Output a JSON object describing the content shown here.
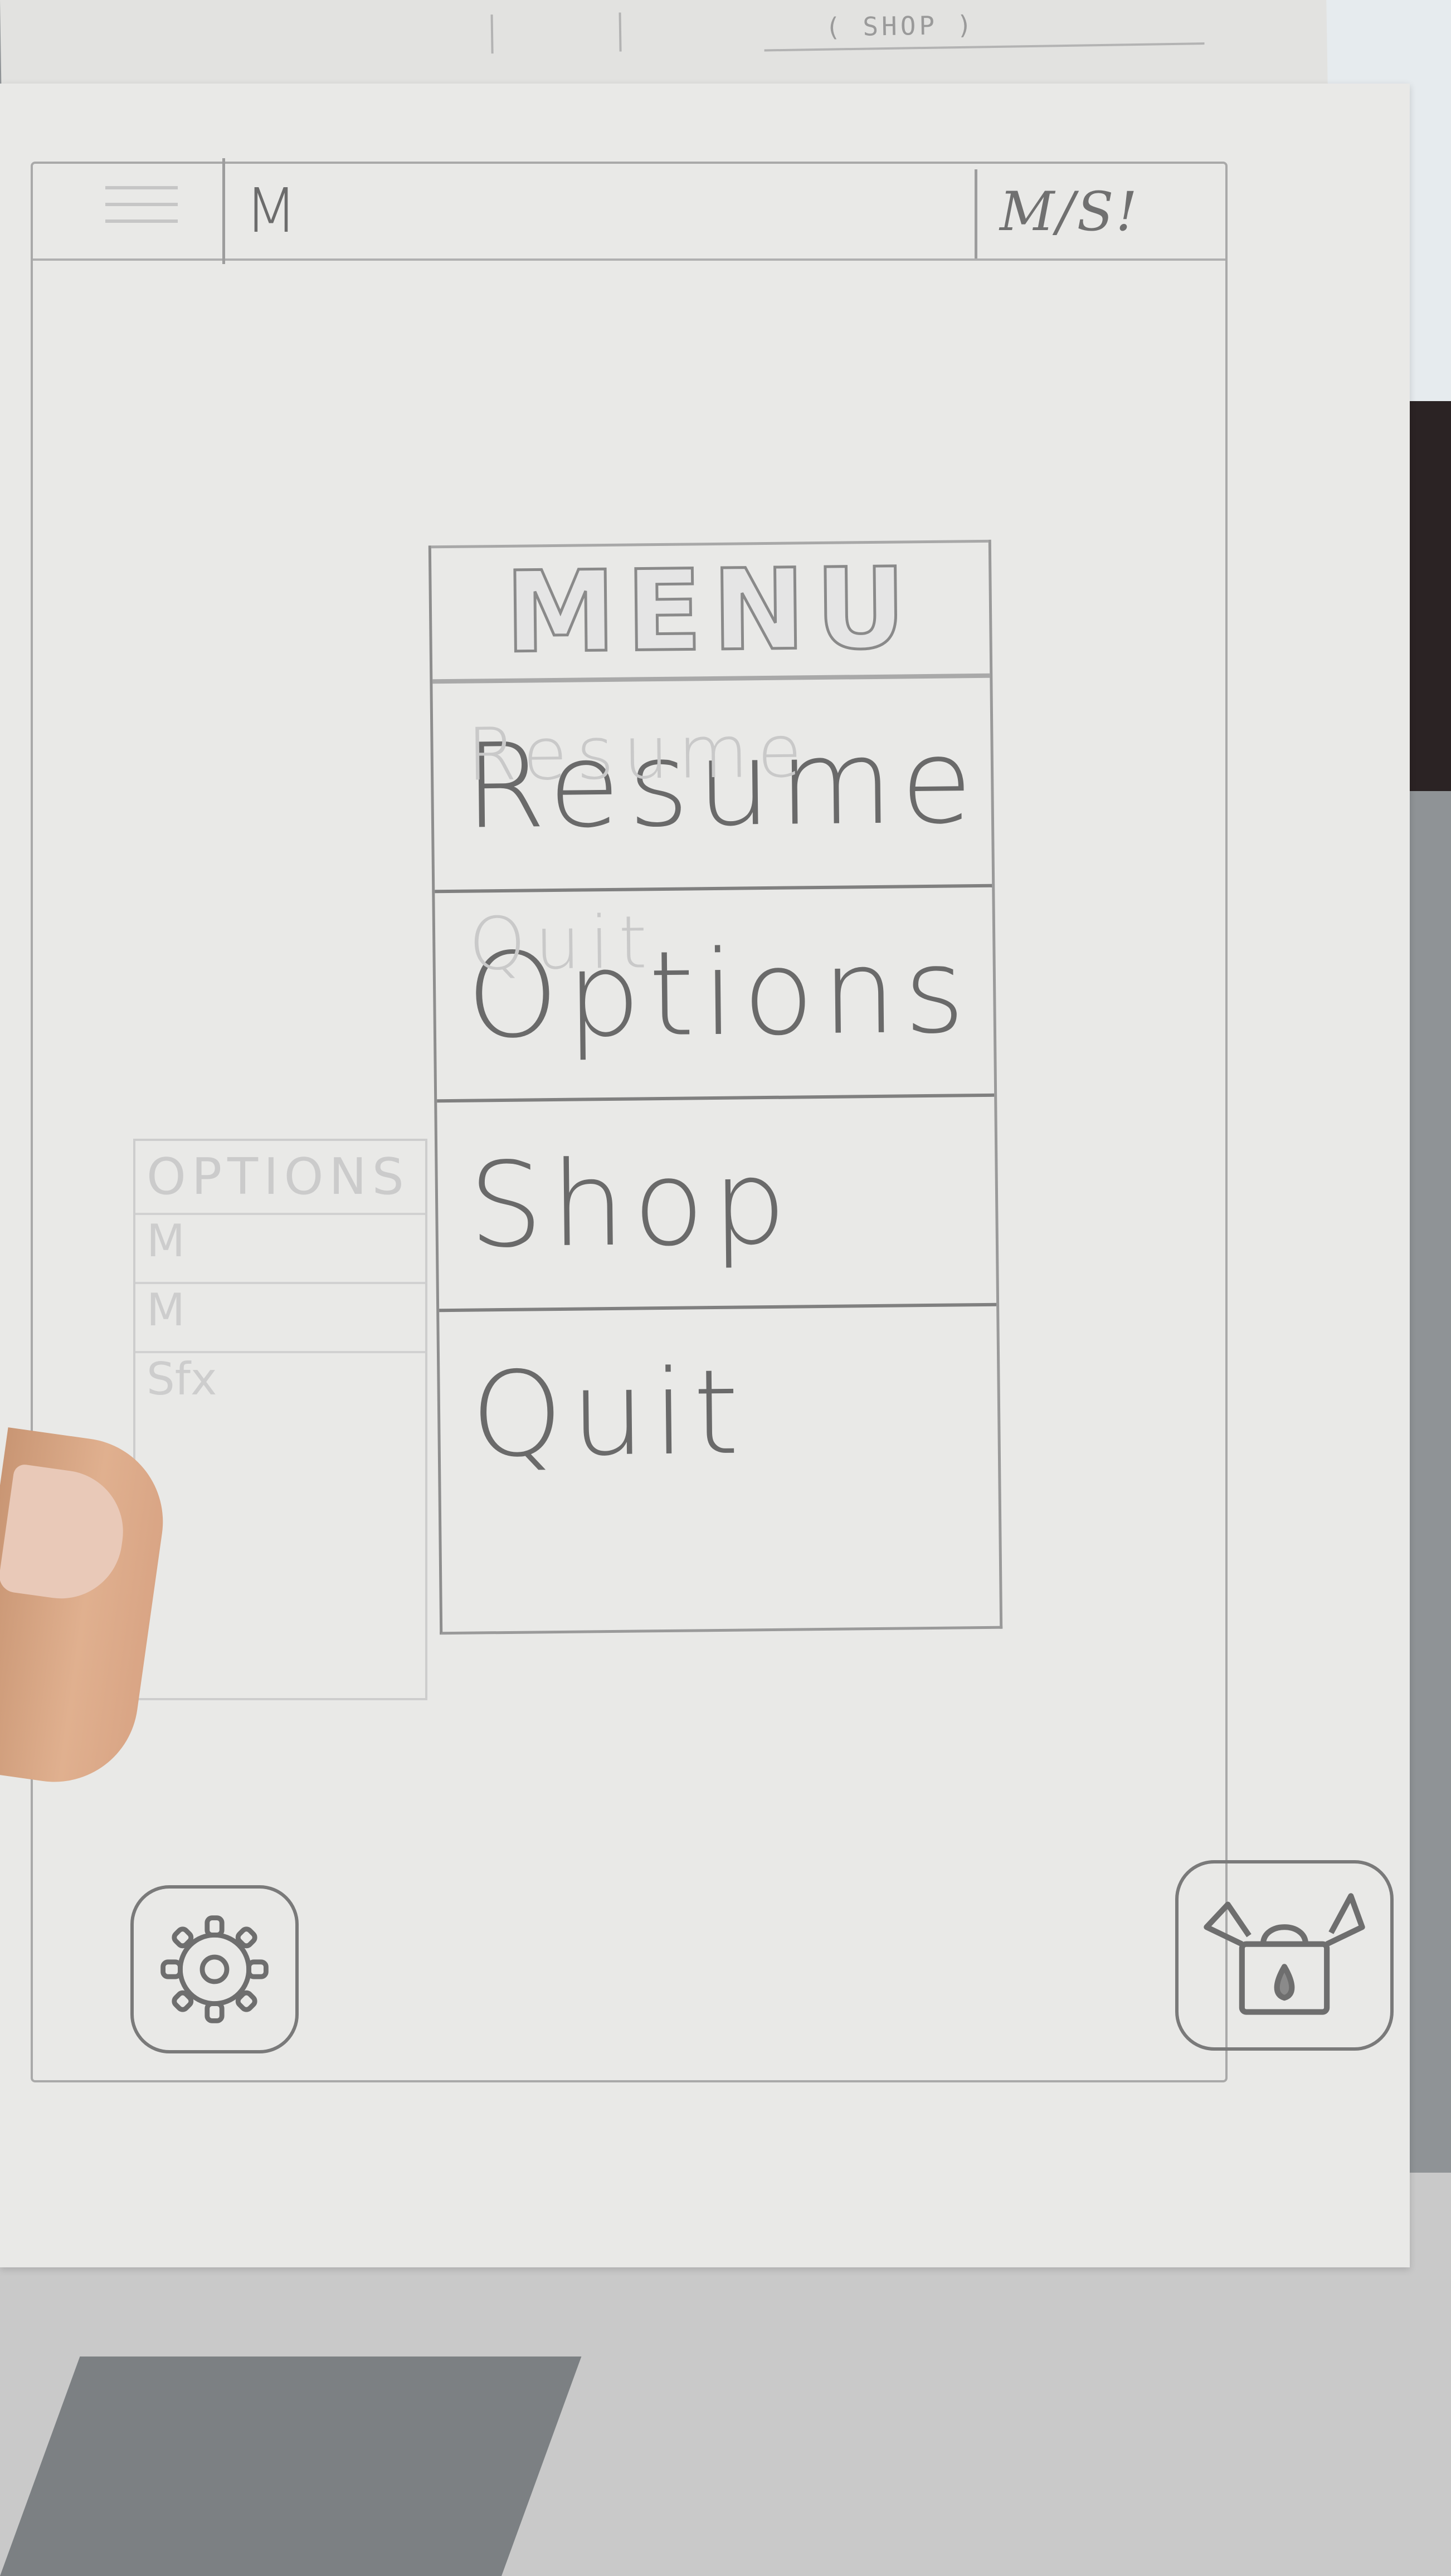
{
  "back_sheet": {
    "shop_label": "( SHOP )"
  },
  "topbar": {
    "left_label": "M",
    "right_label": "M/S!"
  },
  "menu": {
    "title": "MENU",
    "ghost_labels": [
      "Resume",
      "Quit"
    ],
    "items": [
      {
        "label": "Resume"
      },
      {
        "label": "Options"
      },
      {
        "label": "Shop"
      },
      {
        "label": "Quit"
      }
    ]
  },
  "ghost_options": {
    "title": "OPTIONS",
    "rows": [
      "M",
      "M",
      "Sfx"
    ]
  },
  "icons": {
    "settings": "gear-icon",
    "shop": "shop-bag-icon"
  },
  "colors": {
    "pencil": "#6a6a6a",
    "paper": "#e9e9e7"
  }
}
